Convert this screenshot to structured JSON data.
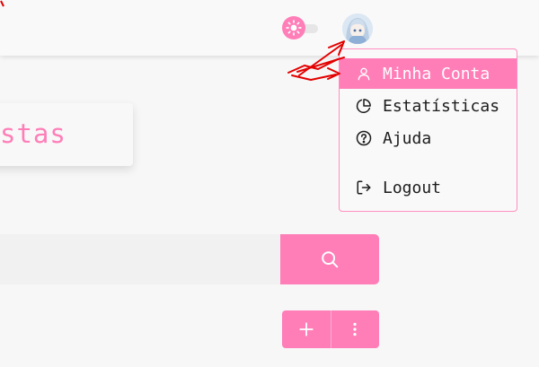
{
  "colors": {
    "accent": "#ff7eb8",
    "dropdown_border": "#ff8fc0",
    "annotation": "#e30000"
  },
  "header": {
    "theme_toggle_icon": "sun-icon",
    "avatar_icon": "user-avatar"
  },
  "page": {
    "title_fragment": "stas"
  },
  "search": {
    "button_icon": "search-icon"
  },
  "actions": {
    "add_icon": "plus-icon",
    "more_icon": "kebab-icon"
  },
  "user_menu": {
    "items": [
      {
        "label": "Minha Conta",
        "icon": "user-icon",
        "active": true
      },
      {
        "label": "Estatísticas",
        "icon": "pie-chart-icon",
        "active": false
      },
      {
        "label": "Ajuda",
        "icon": "help-circle-icon",
        "active": false
      },
      {
        "label": "Logout",
        "icon": "logout-icon",
        "active": false
      }
    ]
  }
}
